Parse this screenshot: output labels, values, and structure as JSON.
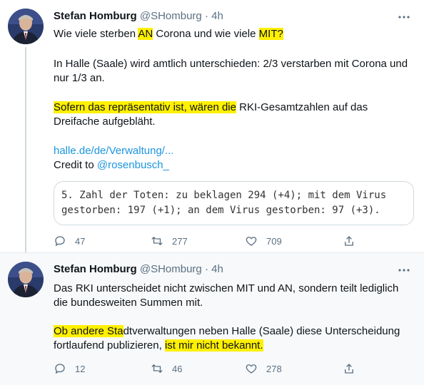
{
  "tweets": [
    {
      "author": {
        "name": "Stefan Homburg",
        "handle": "@SHomburg",
        "time": "4h"
      },
      "text": {
        "line1_pre": "Wie viele sterben ",
        "line1_hl1": "AN",
        "line1_mid": " Corona und wie viele ",
        "line1_hl2": "MIT?",
        "p2": "In Halle (Saale) wird amtlich unterschieden: 2/3 verstarben mit Corona und nur 1/3 an.",
        "p3_hl": "Sofern das repräsentativ ist, wären die",
        "p3_rest": " RKI-Gesamtzahlen auf das Dreifache aufgebläht.",
        "link": "halle.de/de/Verwaltung/...",
        "credit_pre": "Credit to ",
        "credit_mention": "@rosenbusch_"
      },
      "quote": "5. Zahl der Toten: zu beklagen 294 (+4); mit dem Virus gestorben: 197 (+1); an dem Virus gestorben: 97 (+3).",
      "stats": {
        "replies": "47",
        "retweets": "277",
        "likes": "709"
      }
    },
    {
      "author": {
        "name": "Stefan Homburg",
        "handle": "@SHomburg",
        "time": "4h"
      },
      "text": {
        "p1": "Das RKI unterscheidet nicht zwischen MIT und AN, sondern teilt lediglich die bundesweiten Summen mit.",
        "p2_hl1": "Ob andere Sta",
        "p2_rest1": "dtverwaltungen neben Halle (Saale) diese Unterscheidung fortlaufend publizieren, ",
        "p2_hl2": "ist mir nicht bekannt."
      },
      "stats": {
        "replies": "12",
        "retweets": "46",
        "likes": "278"
      }
    }
  ],
  "icons": [
    "more-icon",
    "reply-icon",
    "retweet-icon",
    "like-icon",
    "share-icon"
  ]
}
